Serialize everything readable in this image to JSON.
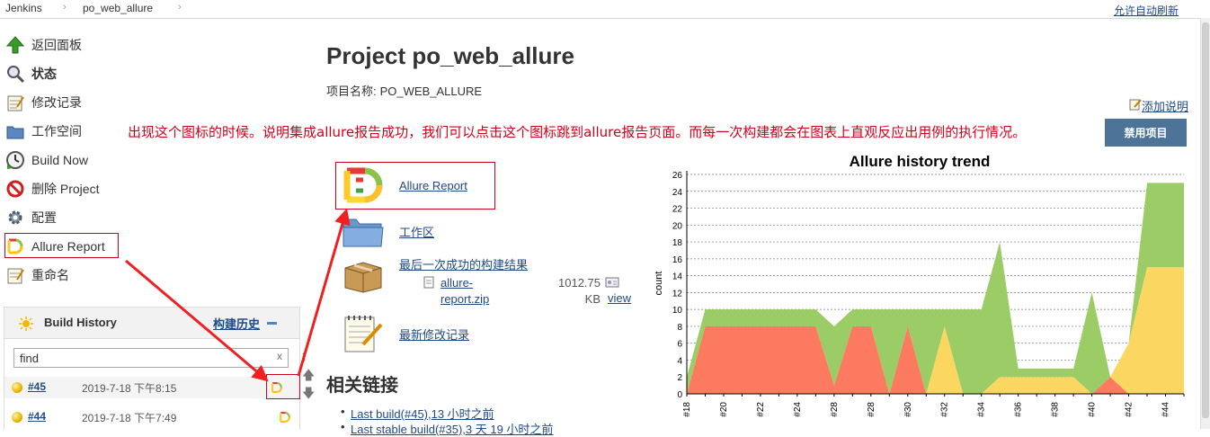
{
  "breadcrumb": {
    "items": [
      "Jenkins",
      "po_web_allure"
    ],
    "autorefresh": "允许自动刷新"
  },
  "sidebar": {
    "items": [
      {
        "label": "返回面板",
        "icon": "up-arrow-icon"
      },
      {
        "label": "状态",
        "icon": "magnifier-icon"
      },
      {
        "label": "修改记录",
        "icon": "notepad-icon"
      },
      {
        "label": "工作空间",
        "icon": "folder-icon"
      },
      {
        "label": "Build Now",
        "icon": "build-clock-icon"
      },
      {
        "label": "删除 Project",
        "icon": "no-entry-icon"
      },
      {
        "label": "配置",
        "icon": "gear-icon"
      },
      {
        "label": "Allure Report",
        "icon": "allure-logo-icon"
      },
      {
        "label": "重命名",
        "icon": "notepad-icon"
      }
    ]
  },
  "build_history": {
    "title": "Build History",
    "trend_label": "构建历史",
    "find_value": "find",
    "clear": "x",
    "builds": [
      {
        "number": "#45",
        "date": "2019-7-18 下午8:15"
      },
      {
        "number": "#44",
        "date": "2019-7-18 下午7:49"
      }
    ]
  },
  "project": {
    "title": "Project po_web_allure",
    "name_label": "项目名称:",
    "name_value": "PO_WEB_ALLURE",
    "add_description": "添加说明",
    "disable_button": "禁用项目"
  },
  "annotation": "出现这个图标的时候。说明集成allure报告成功，我们可以点击这个图标跳到allure报告页面。而每一次构建都会在图表上直观反应出用例的执行情况。",
  "links": {
    "allure_report": "Allure Report",
    "workspace": "工作区",
    "last_success": "最后一次成功的构建结果",
    "artifact_file_1": "allure-",
    "artifact_file_2": "report.zip",
    "artifact_size_1": "1012.75",
    "artifact_size_2": "KB",
    "artifact_view": "view",
    "changes": "最新修改记录"
  },
  "related": {
    "title": "相关链接",
    "items": [
      "Last build(#45),13 小时之前",
      "Last stable build(#35),3 天 19 小时之前"
    ]
  },
  "colors": {
    "failed": "#fc7b60",
    "broken": "#fbd762",
    "passed": "#9ccc65",
    "accent": "#d0021b"
  },
  "chart_data": {
    "type": "area",
    "title": "Allure history trend",
    "ylabel": "count",
    "xlabel": "",
    "ylim": [
      0,
      26
    ],
    "yticks": [
      0,
      2,
      4,
      6,
      8,
      10,
      12,
      14,
      16,
      18,
      20,
      22,
      24,
      26
    ],
    "x": [
      18,
      19,
      20,
      21,
      22,
      23,
      24,
      25,
      26,
      27,
      28,
      29,
      30,
      31,
      32,
      33,
      34,
      35,
      36,
      37,
      38,
      39,
      40,
      41,
      42,
      43,
      44,
      45
    ],
    "xtick_labels": [
      "#18",
      "#20",
      "#22",
      "#24",
      "#28",
      "#28",
      "#30",
      "#32",
      "#34",
      "#36",
      "#38",
      "#40",
      "#42",
      "#44"
    ],
    "xtick_positions": [
      18,
      20,
      22,
      24,
      26,
      28,
      30,
      32,
      34,
      36,
      38,
      40,
      42,
      44
    ],
    "grid": true,
    "series": [
      {
        "color": "#fc7b60",
        "values": [
          0,
          8,
          8,
          8,
          8,
          8,
          8,
          8,
          1,
          8,
          8,
          0,
          8,
          0,
          0,
          0,
          0,
          0,
          0,
          0,
          0,
          0,
          0,
          2,
          0,
          0,
          0,
          0
        ]
      },
      {
        "color": "#fbd762",
        "values": [
          0,
          0,
          0,
          0,
          0,
          0,
          0,
          0,
          0,
          0,
          0,
          0,
          0,
          0,
          8,
          0,
          0,
          2,
          2,
          2,
          2,
          2,
          0,
          0,
          6,
          15,
          15,
          15
        ]
      },
      {
        "color": "#9ccc65",
        "values": [
          2,
          2,
          2,
          2,
          2,
          2,
          2,
          2,
          7,
          2,
          2,
          10,
          2,
          10,
          2,
          10,
          10,
          16,
          1,
          1,
          1,
          1,
          12,
          0,
          0,
          10,
          10,
          10
        ]
      }
    ]
  }
}
